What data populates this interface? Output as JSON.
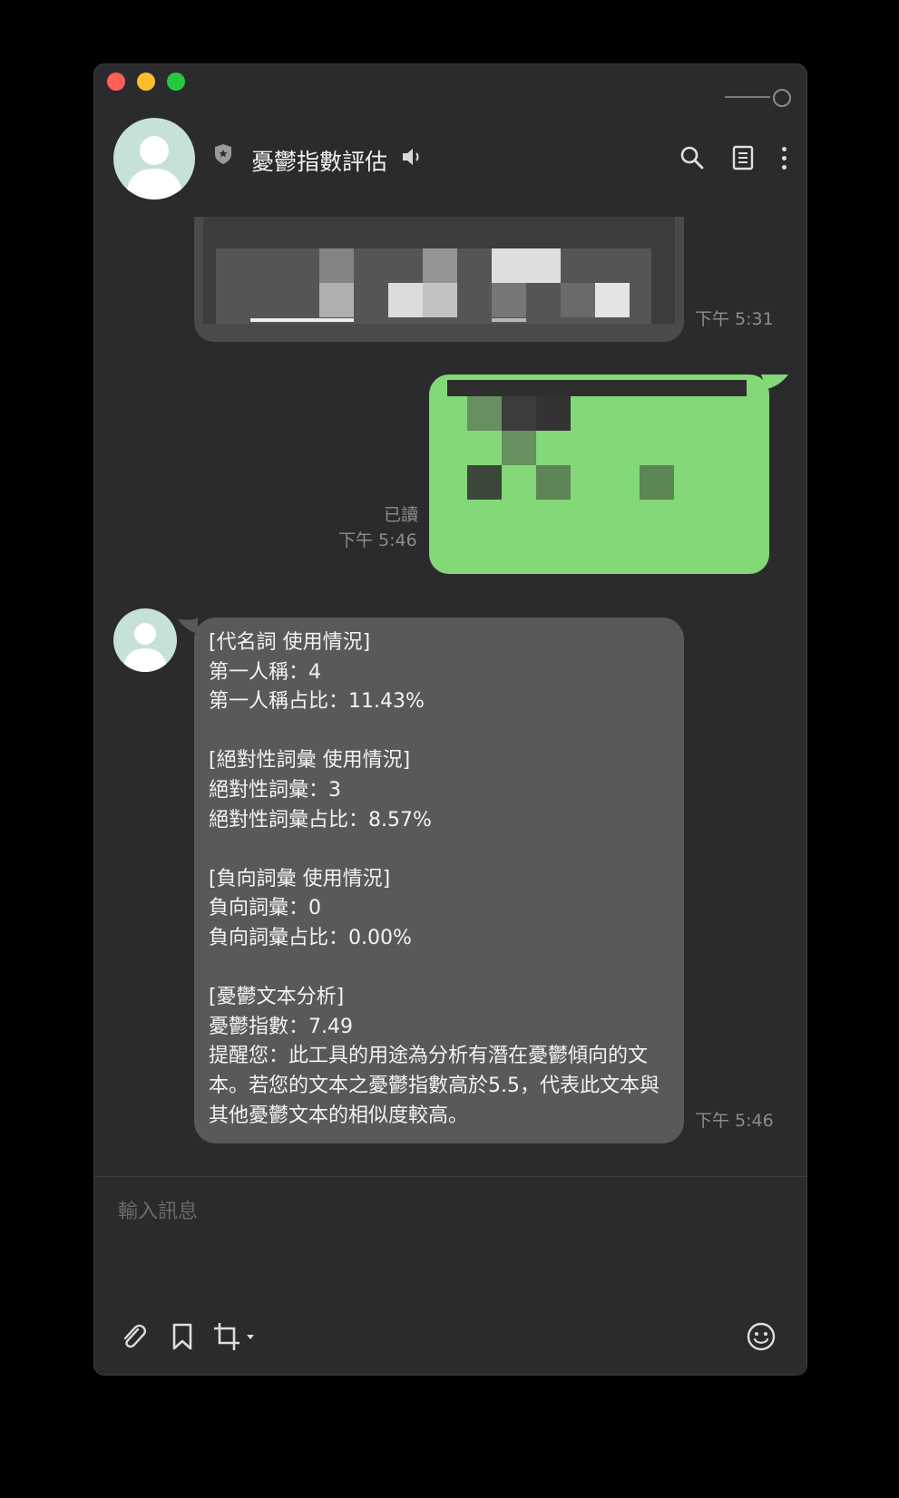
{
  "header": {
    "title": "憂鬱指數評估"
  },
  "messages": [
    {
      "type": "image",
      "sender": "bot",
      "time": "下午 5:31"
    },
    {
      "type": "image",
      "sender": "self",
      "read": "已讀",
      "time": "下午 5:46"
    },
    {
      "type": "text",
      "sender": "bot",
      "time": "下午 5:46",
      "text": "[代名詞 使用情況]\n第一人稱：4\n第一人稱占比：11.43%\n\n[絕對性詞彙 使用情況]\n絕對性詞彙：3\n絕對性詞彙占比：8.57%\n\n[負向詞彙 使用情況]\n負向詞彙：0\n負向詞彙占比：0.00%\n\n[憂鬱文本分析]\n憂鬱指數：7.49\n提醒您：此工具的用途為分析有潛在憂鬱傾向的文本。若您的文本之憂鬱指數高於5.5，代表此文本與其他憂鬱文本的相似度較高。"
    }
  ],
  "input": {
    "placeholder": "輸入訊息"
  },
  "colors": {
    "window_bg": "#2b2b2d",
    "self_bubble": "#83d878",
    "bot_bubble": "#595959",
    "avatar_bg": "#c6e2d8"
  },
  "icons": [
    "search-icon",
    "note-icon",
    "more-icon",
    "paperclip-icon",
    "bookmark-icon",
    "crop-icon",
    "emoji-icon",
    "speaker-icon",
    "shield-icon"
  ]
}
